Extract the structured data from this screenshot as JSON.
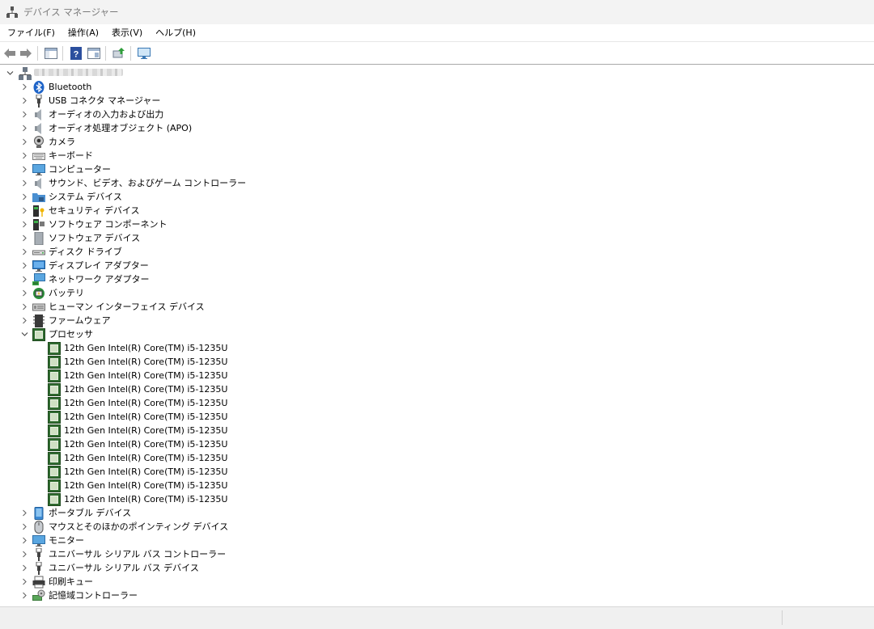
{
  "window": {
    "title": "デバイス マネージャー"
  },
  "menu": [
    "ファイル(F)",
    "操作(A)",
    "表示(V)",
    "ヘルプ(H)"
  ],
  "toolbar": {
    "buttons": [
      {
        "name": "back-button",
        "icon": "arrow-left-icon"
      },
      {
        "name": "forward-button",
        "icon": "arrow-right-icon"
      },
      {
        "name": "show-hide-console-tree-button",
        "icon": "console-tree-icon"
      },
      {
        "name": "help-button",
        "icon": "help-icon"
      },
      {
        "name": "properties-button",
        "icon": "properties-icon"
      },
      {
        "name": "update-driver-button",
        "icon": "update-driver-icon"
      },
      {
        "name": "scan-hardware-button",
        "icon": "monitor-scan-icon"
      }
    ]
  },
  "tree": {
    "root": {
      "label": "",
      "icon": "computer-network-icon",
      "expanded": true,
      "label_obscured": true
    },
    "categories": [
      {
        "label": "Bluetooth",
        "icon": "bluetooth-icon",
        "expanded": false
      },
      {
        "label": "USB コネクタ マネージャー",
        "icon": "usb-icon",
        "expanded": false
      },
      {
        "label": "オーディオの入力および出力",
        "icon": "speaker-icon",
        "expanded": false
      },
      {
        "label": "オーディオ処理オブジェクト (APO)",
        "icon": "speaker-icon",
        "expanded": false
      },
      {
        "label": "カメラ",
        "icon": "camera-icon",
        "expanded": false
      },
      {
        "label": "キーボード",
        "icon": "keyboard-icon",
        "expanded": false
      },
      {
        "label": "コンピューター",
        "icon": "computer-icon",
        "expanded": false
      },
      {
        "label": "サウンド、ビデオ、およびゲーム コントローラー",
        "icon": "speaker-icon",
        "expanded": false
      },
      {
        "label": "システム デバイス",
        "icon": "system-folder-icon",
        "expanded": false
      },
      {
        "label": "セキュリティ デバイス",
        "icon": "security-key-icon",
        "expanded": false
      },
      {
        "label": "ソフトウェア コンポーネント",
        "icon": "software-component-icon",
        "expanded": false
      },
      {
        "label": "ソフトウェア デバイス",
        "icon": "software-device-icon",
        "expanded": false
      },
      {
        "label": "ディスク ドライブ",
        "icon": "disk-drive-icon",
        "expanded": false
      },
      {
        "label": "ディスプレイ アダプター",
        "icon": "display-adapter-icon",
        "expanded": false
      },
      {
        "label": "ネットワーク アダプター",
        "icon": "network-adapter-icon",
        "expanded": false
      },
      {
        "label": "バッテリ",
        "icon": "battery-icon",
        "expanded": false
      },
      {
        "label": "ヒューマン インターフェイス デバイス",
        "icon": "hid-icon",
        "expanded": false
      },
      {
        "label": "ファームウェア",
        "icon": "firmware-icon",
        "expanded": false
      },
      {
        "label": "プロセッサ",
        "icon": "processor-icon",
        "expanded": true,
        "children": [
          "12th Gen Intel(R) Core(TM) i5-1235U",
          "12th Gen Intel(R) Core(TM) i5-1235U",
          "12th Gen Intel(R) Core(TM) i5-1235U",
          "12th Gen Intel(R) Core(TM) i5-1235U",
          "12th Gen Intel(R) Core(TM) i5-1235U",
          "12th Gen Intel(R) Core(TM) i5-1235U",
          "12th Gen Intel(R) Core(TM) i5-1235U",
          "12th Gen Intel(R) Core(TM) i5-1235U",
          "12th Gen Intel(R) Core(TM) i5-1235U",
          "12th Gen Intel(R) Core(TM) i5-1235U",
          "12th Gen Intel(R) Core(TM) i5-1235U",
          "12th Gen Intel(R) Core(TM) i5-1235U"
        ]
      },
      {
        "label": "ポータブル デバイス",
        "icon": "portable-device-icon",
        "expanded": false
      },
      {
        "label": "マウスとそのほかのポインティング デバイス",
        "icon": "mouse-icon",
        "expanded": false
      },
      {
        "label": "モニター",
        "icon": "monitor-icon",
        "expanded": false
      },
      {
        "label": "ユニバーサル シリアル バス コントローラー",
        "icon": "usb-icon",
        "expanded": false
      },
      {
        "label": "ユニバーサル シリアル バス デバイス",
        "icon": "usb-icon",
        "expanded": false
      },
      {
        "label": "印刷キュー",
        "icon": "printer-icon",
        "expanded": false
      },
      {
        "label": "記憶域コントローラー",
        "icon": "storage-controller-icon",
        "expanded": false
      }
    ]
  }
}
